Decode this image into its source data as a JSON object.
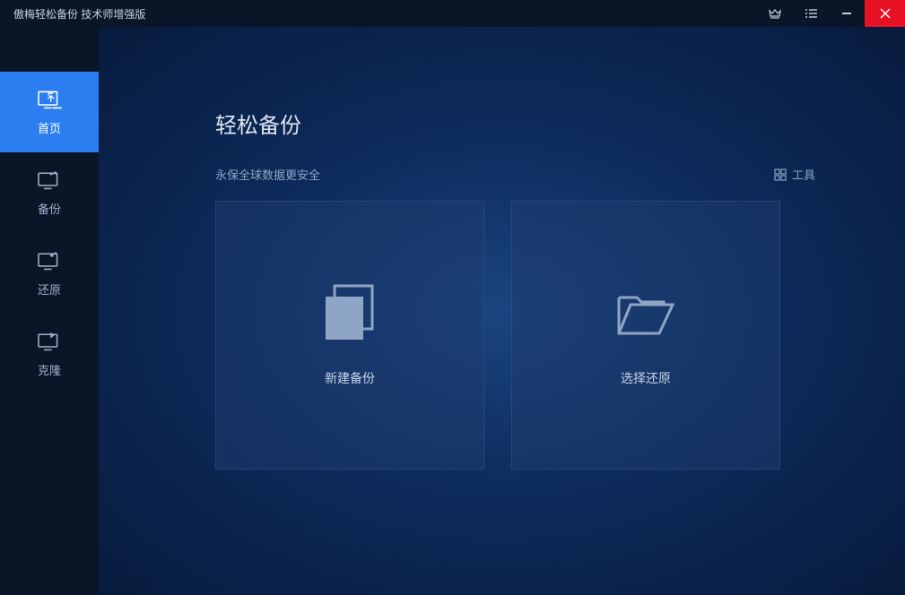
{
  "app": {
    "title": "傲梅轻松备份 技术师增强版"
  },
  "sidebar": {
    "items": [
      {
        "label": "首页"
      },
      {
        "label": "备份"
      },
      {
        "label": "还原"
      },
      {
        "label": "克隆"
      }
    ]
  },
  "content": {
    "title": "轻松备份",
    "subtitle": "永保全球数据更安全",
    "tools_label": "工具",
    "cards": [
      {
        "label": "新建备份"
      },
      {
        "label": "选择还原"
      }
    ]
  }
}
